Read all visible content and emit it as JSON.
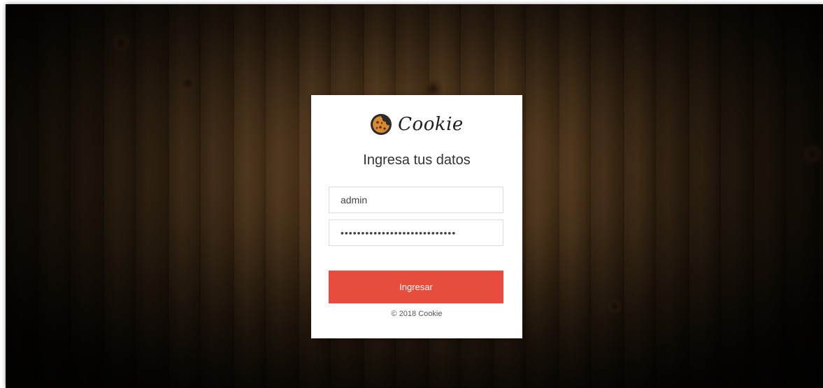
{
  "brand": {
    "name": "Cookie",
    "icon": "cookie-icon"
  },
  "login": {
    "heading": "Ingresa tus datos",
    "username_value": "admin",
    "password_value": "••••••••••••••••••••••••••••",
    "submit_label": "Ingresar",
    "footer": "© 2018 Cookie"
  },
  "colors": {
    "accent": "#e74c3c",
    "card": "#ffffff",
    "text": "#333333"
  }
}
